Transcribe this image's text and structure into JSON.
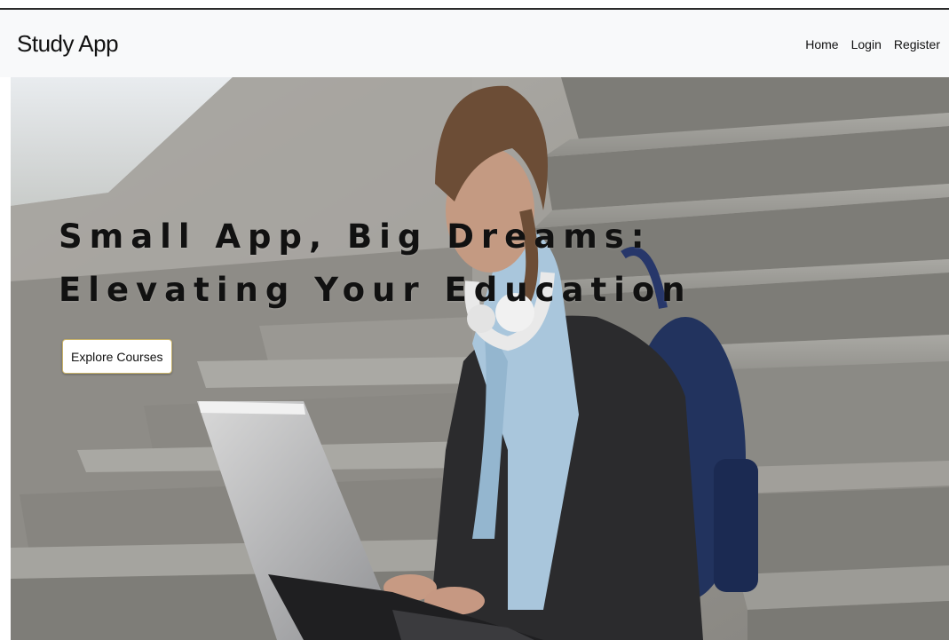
{
  "navbar": {
    "brand": "Study App",
    "links": [
      "Home",
      "Login",
      "Register"
    ]
  },
  "hero": {
    "headline_line1": "Small App, Big Dreams:",
    "headline_line2": "Elevating Your Education",
    "cta_label": "Explore Courses"
  }
}
